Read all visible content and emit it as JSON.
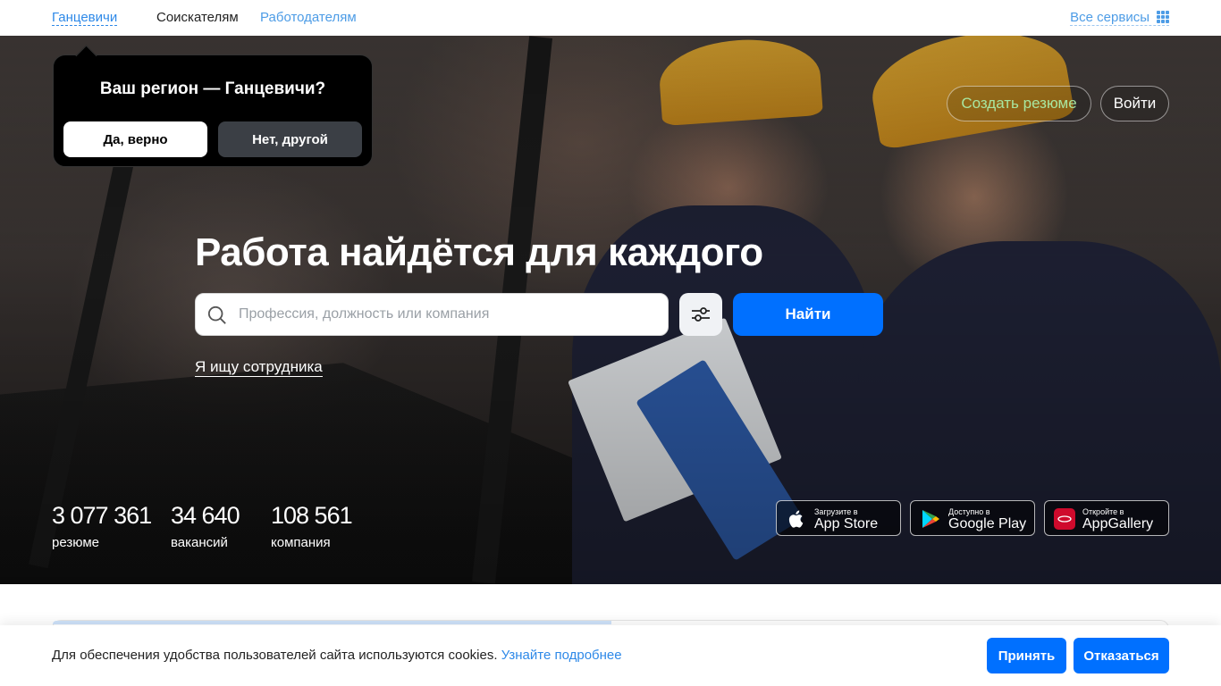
{
  "topbar": {
    "region": "Ганцевичи",
    "nav": {
      "seekers": "Соискателям",
      "employers": "Работодателям"
    },
    "all_services": "Все сервисы",
    "all_services_icon": "grid-icon"
  },
  "region_popup": {
    "question": "Ваш регион — Ганцевичи?",
    "yes": "Да, верно",
    "no": "Нет, другой"
  },
  "hero": {
    "create_resume": "Создать резюме",
    "login": "Войти",
    "headline": "Работа найдётся для каждого",
    "search": {
      "placeholder": "Профессия, должность или компания",
      "value": "",
      "icon": "search-icon"
    },
    "filter_icon": "sliders-icon",
    "find": "Найти",
    "employer_link": "Я ищу сотрудника",
    "stats": [
      {
        "value": "3 077 361",
        "label": "резюме"
      },
      {
        "value": "34 640",
        "label": "вакансий"
      },
      {
        "value": "108 561",
        "label": "компания"
      }
    ],
    "stores": [
      {
        "small": "Загрузите в",
        "big": "App Store",
        "icon": "apple-icon"
      },
      {
        "small": "Доступно в",
        "big": "Google Play",
        "icon": "google-play-icon"
      },
      {
        "small": "Откройте в",
        "big": "AppGallery",
        "icon": "huawei-icon"
      }
    ]
  },
  "cookie": {
    "text": "Для обеспечения удобства пользователей сайта используются cookies.",
    "more": "Узнайте подробнее",
    "accept": "Принять",
    "decline": "Отказаться"
  },
  "colors": {
    "accent": "#0070ff",
    "link": "#2e89e8",
    "resume_text": "#a8e6a0",
    "popup_bg": "#000000"
  }
}
